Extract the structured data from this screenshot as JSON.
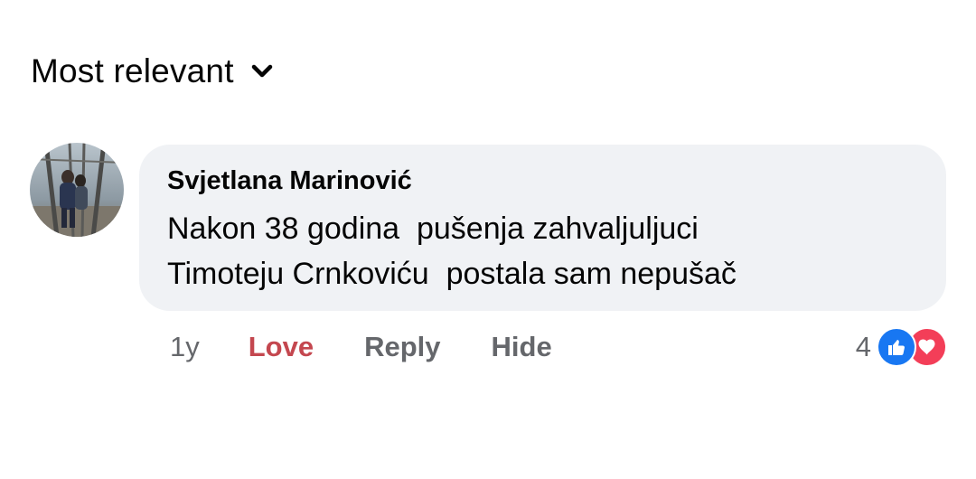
{
  "sort": {
    "label": "Most relevant",
    "icon": "chevron-down-icon"
  },
  "comment": {
    "author": "Svjetlana Marinović",
    "text": "Nakon 38 godina  pušenja zahvaljuljuci\nTimoteju Crnkoviću  postala sam nepušač",
    "avatar_icon": "profile-photo",
    "time": "1y",
    "actions": {
      "love": "Love",
      "reply": "Reply",
      "hide": "Hide"
    },
    "reaction_count": "4",
    "reaction_icons": [
      "like-icon",
      "love-icon"
    ]
  },
  "colors": {
    "bubble": "#f0f2f5",
    "love_action": "#c4474f",
    "meta_gray": "#65676b",
    "like_blue": "#1877f2",
    "love_red": "#f33e58"
  }
}
